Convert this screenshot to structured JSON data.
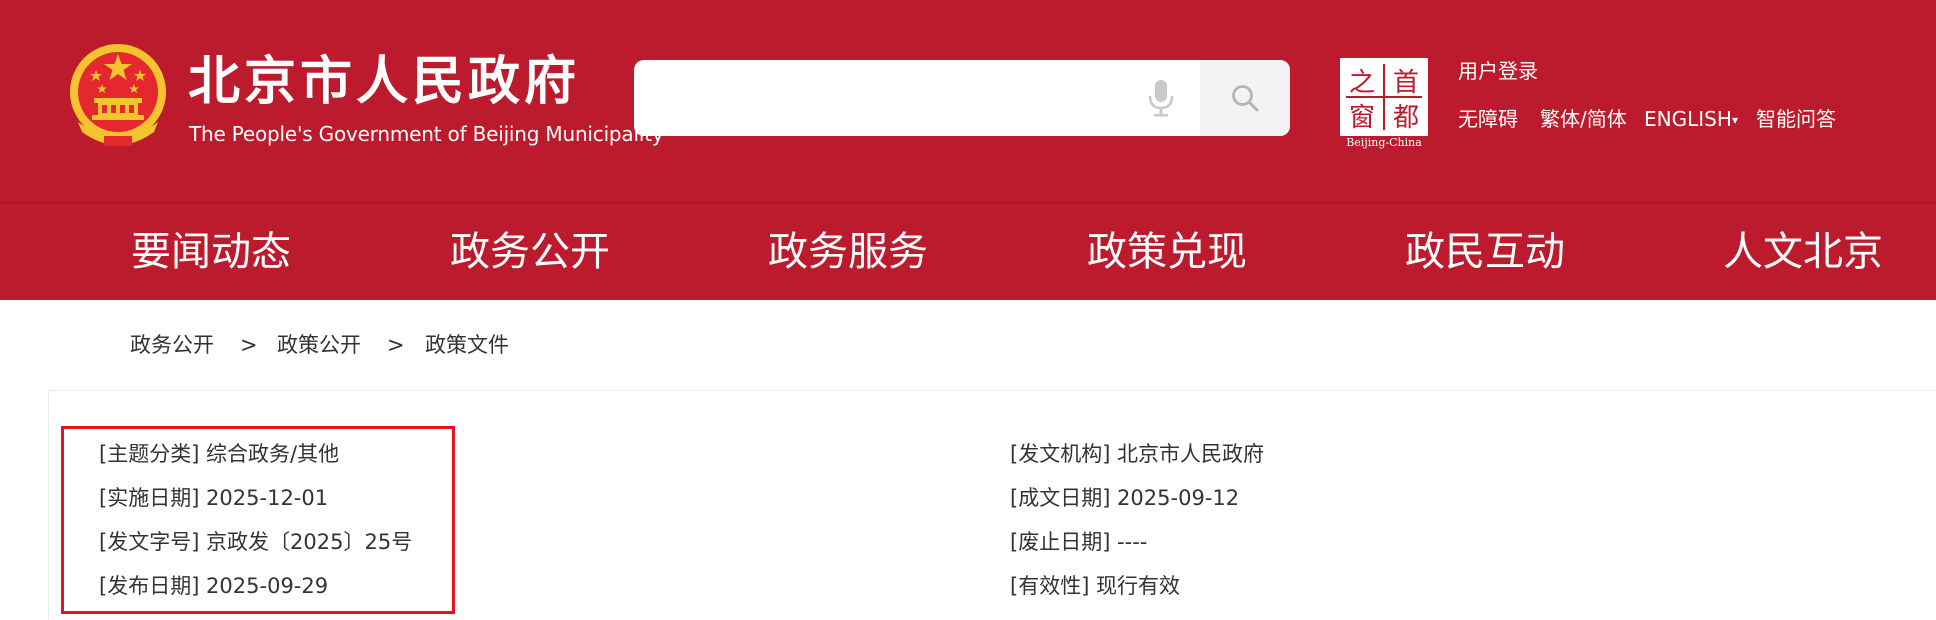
{
  "header": {
    "title": "北京市人民政府",
    "subtitle": "The People's Government of Beijing Municipality",
    "search": {
      "placeholder": "",
      "value": ""
    },
    "window_logo": {
      "chars": [
        "首",
        "之",
        "都",
        "窗"
      ],
      "caption": "Beijing-China"
    },
    "login": "用户登录",
    "links": {
      "accessibility": "无障碍",
      "traditional_simplified": "繁体/简体",
      "english": "ENGLISH",
      "english_caret": "▾",
      "assistant": "智能问答"
    }
  },
  "nav": {
    "items": [
      "要闻动态",
      "政务公开",
      "政务服务",
      "政策兑现",
      "政民互动",
      "人文北京"
    ]
  },
  "breadcrumb": {
    "items": [
      "政务公开",
      "政策公开",
      "政策文件"
    ],
    "separator": ">"
  },
  "meta": {
    "left": [
      "[主题分类] 综合政务/其他",
      "[实施日期] 2025-12-01",
      "[发文字号] 京政发〔2025〕25号",
      "[发布日期] 2025-09-29"
    ],
    "right": [
      "[发文机构] 北京市人民政府",
      "[成文日期] 2025-09-12",
      "[废止日期] ----",
      "[有效性] 现行有效"
    ]
  },
  "colors": {
    "brand_red": "#bc1b2d",
    "highlight_red": "#e6141e",
    "emblem_gold": "#f4c430"
  },
  "icons": {
    "emblem": "national-emblem-icon",
    "mic": "microphone-icon",
    "search": "search-icon"
  }
}
